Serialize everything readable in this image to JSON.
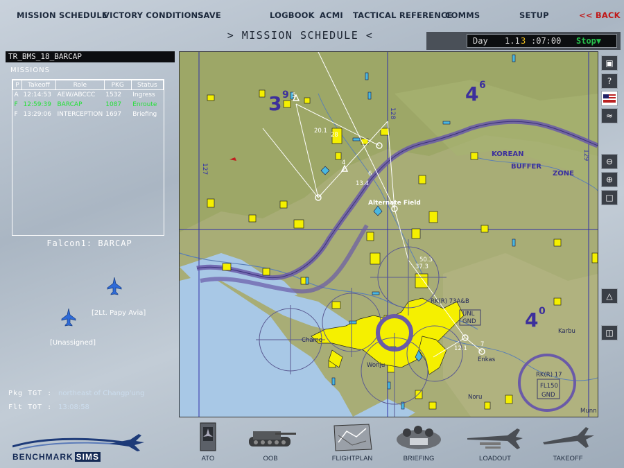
{
  "menu": {
    "mission_schedule": "MISSION SCHEDULE",
    "victory_conditions": "VICTORY CONDITIONS",
    "save": "SAVE",
    "logbook": "LOGBOOK",
    "acmi": "ACMI",
    "tactical_reference": "TACTICAL REFERENCE",
    "comms": "COMMS",
    "setup": "SETUP",
    "back": "<< BACK"
  },
  "title": ">  MISSION SCHEDULE  <",
  "clock": {
    "label": "Day",
    "day": "1",
    "hour": ".1",
    "minute": "3",
    "rest": ":07:00",
    "stop": "Stop▼"
  },
  "package": {
    "title": "TR_BMS_18_BARCAP",
    "missions_label": "MISSIONS",
    "columns": [
      "P",
      "Takeoff",
      "Role",
      "PKG",
      "Status"
    ],
    "rows": [
      {
        "p": "A",
        "takeoff": "12:14:53",
        "role": "AEW/ABCCC",
        "pkg": "1532",
        "status": "Ingress"
      },
      {
        "p": "F",
        "takeoff": "12:59:39",
        "role": "BARCAP",
        "pkg": "1087",
        "status": "Enroute"
      },
      {
        "p": "F",
        "takeoff": "13:29:06",
        "role": "INTERCEPTION",
        "pkg": "1697",
        "status": "Briefing"
      }
    ],
    "flight_title": "Falcon1: BARCAP",
    "pilots": [
      "[2Lt. Papy Avia]",
      "[Unassigned]"
    ],
    "pkg_tgt_label": "Pkg TGT  :",
    "pkg_tgt_value": "northeast of Changp'ung",
    "flt_tot_label": "Flt TOT  :",
    "flt_tot_value": "13:08:58"
  },
  "map": {
    "sectors": [
      {
        "main": "3",
        "sup": "9"
      },
      {
        "main": "4",
        "sup": "6"
      },
      {
        "main": "4",
        "sup": "0"
      }
    ],
    "labels": {
      "korean": "KOREAN",
      "buffer": "BUFFER",
      "zone": "ZONE",
      "alternate": "Alternate Field",
      "chamo": "Chamo",
      "wonju": "Wonju",
      "enkas": "Enkas",
      "karbu": "Karbu",
      "noru": "Noru",
      "munn": "Munn",
      "rk73": "RK(R) 73A&B",
      "unl": "UNL",
      "gnd": "GND",
      "rk17": "RK(R) 17",
      "fl150": "FL150",
      "gnd2": "GND"
    },
    "waypoints": [
      "5",
      "20.1",
      "28",
      "4",
      "6",
      "13.4",
      "50.3",
      "37.3",
      "12.1",
      "7"
    ],
    "gridlines": [
      "127",
      "128",
      "129"
    ]
  },
  "map_tools": [
    "map-layers-icon",
    "help-icon",
    "flag-icon",
    "terrain-icon",
    "zoom-out-icon",
    "zoom-in-icon",
    "fit-icon",
    "threat-icon",
    "unit-icon"
  ],
  "logo": {
    "text": "BENCHMARK",
    "sims": "SIMS"
  },
  "nav": [
    "ATO",
    "OOB",
    "FLIGHTPLAN",
    "BRIEFING",
    "LOADOUT",
    "TAKEOFF"
  ],
  "colors": {
    "accent_back": "#c01818",
    "selected_row": "#25e038",
    "airbase": "#f5f000",
    "border_line": "#6a5aa8"
  }
}
